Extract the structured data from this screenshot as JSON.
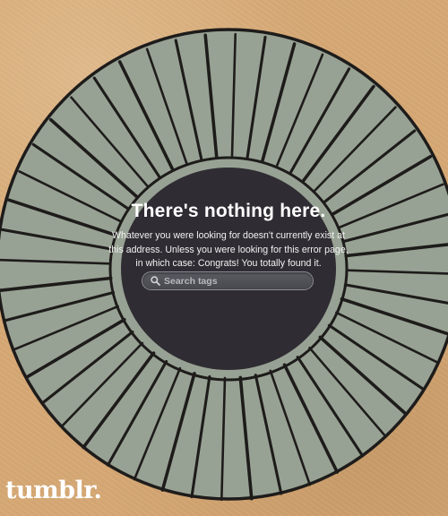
{
  "page": {
    "title": "There's nothing here.",
    "message_lines": [
      "Whatever you were looking for doesn't currently exist at",
      "this address. Unless you were looking for this error page,",
      "in which case: Congrats! You totally found it."
    ]
  },
  "search": {
    "placeholder": "Search tags",
    "value": "",
    "icon": "magnifier-icon"
  },
  "brand": {
    "logo_text": "tumblr."
  },
  "colors": {
    "background": "#d6a874",
    "ring_fill": "#98a294",
    "ring_stroke": "#1e1c1b",
    "center_fill": "#2f2c33",
    "text": "#ffffff"
  }
}
